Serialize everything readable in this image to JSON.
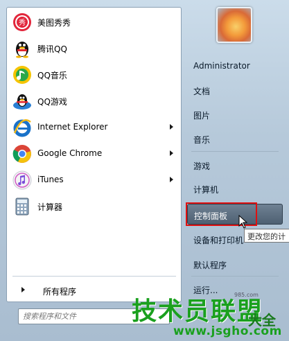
{
  "programs": [
    {
      "label": "美图秀秀",
      "icon": "meitu-icon",
      "has_submenu": false
    },
    {
      "label": "腾讯QQ",
      "icon": "qq-penguin-icon",
      "has_submenu": false
    },
    {
      "label": "QQ音乐",
      "icon": "qq-music-icon",
      "has_submenu": false
    },
    {
      "label": "QQ游戏",
      "icon": "qq-game-icon",
      "has_submenu": false
    },
    {
      "label": "Internet Explorer",
      "icon": "internet-explorer-icon",
      "has_submenu": true
    },
    {
      "label": "Google Chrome",
      "icon": "chrome-icon",
      "has_submenu": true
    },
    {
      "label": "iTunes",
      "icon": "itunes-icon",
      "has_submenu": true
    },
    {
      "label": "计算器",
      "icon": "calculator-icon",
      "has_submenu": false
    }
  ],
  "all_programs_label": "所有程序",
  "search": {
    "placeholder": "搜索程序和文件"
  },
  "right_menu": {
    "user": "Administrator",
    "documents": "文档",
    "pictures": "图片",
    "music": "音乐",
    "games": "游戏",
    "computer": "计算机",
    "control_panel": "控制面板",
    "devices_printers": "设备和打印机",
    "default_programs": "默认程序",
    "run": "运行..."
  },
  "tooltip": "更改您的计",
  "watermark": {
    "main": "技术员联盟",
    "side": "大全",
    "url": "www.jsgho.com",
    "small": "985.com"
  },
  "colors": {
    "highlight": "#e01010",
    "selected_item": "#4e6072",
    "watermark": "#1aa01e"
  }
}
